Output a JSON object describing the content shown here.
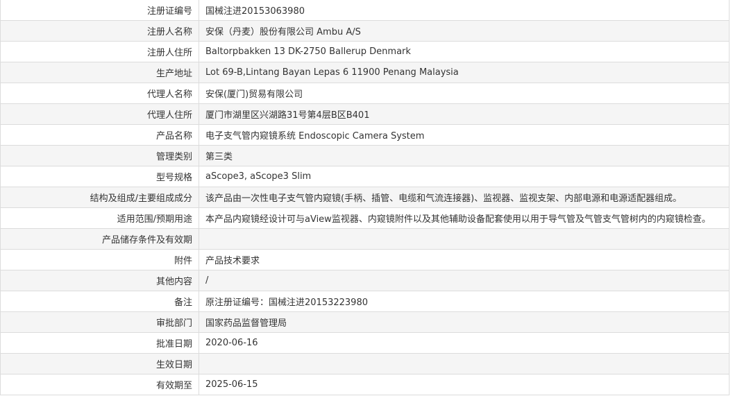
{
  "rows": [
    {
      "label": "注册证编号",
      "value": "国械注进20153063980"
    },
    {
      "label": "注册人名称",
      "value": "安保（丹麦）股份有限公司 Ambu A/S"
    },
    {
      "label": "注册人住所",
      "value": "Baltorpbakken 13 DK-2750 Ballerup Denmark"
    },
    {
      "label": "生产地址",
      "value": "Lot 69-B,Lintang Bayan Lepas 6 11900 Penang Malaysia"
    },
    {
      "label": "代理人名称",
      "value": "安保(厦门)贸易有限公司"
    },
    {
      "label": "代理人住所",
      "value": "厦门市湖里区兴湖路31号第4层B区B401"
    },
    {
      "label": "产品名称",
      "value": "电子支气管内窥镜系统 Endoscopic Camera System"
    },
    {
      "label": "管理类别",
      "value": "第三类"
    },
    {
      "label": "型号规格",
      "value": "aScope3, aScope3 Slim"
    },
    {
      "label": "结构及组成/主要组成成分",
      "value": "该产品由一次性电子支气管内窥镜(手柄、插管、电缆和气流连接器)、监视器、监视支架、内部电源和电源适配器组成。"
    },
    {
      "label": "适用范围/预期用途",
      "value": "本产品内窥镜经设计可与aView监视器、内窥镜附件以及其他辅助设备配套使用以用于导气管及气管支气管树内的内窥镜检查。"
    },
    {
      "label": "产品储存条件及有效期",
      "value": ""
    },
    {
      "label": "附件",
      "value": "产品技术要求"
    },
    {
      "label": "其他内容",
      "value": "/"
    },
    {
      "label": "备注",
      "value": "原注册证编号：国械注进20153223980"
    },
    {
      "label": "审批部门",
      "value": "国家药品监督管理局"
    },
    {
      "label": "批准日期",
      "value": "2020-06-16"
    },
    {
      "label": "生效日期",
      "value": ""
    },
    {
      "label": "有效期至",
      "value": "2025-06-15"
    }
  ]
}
